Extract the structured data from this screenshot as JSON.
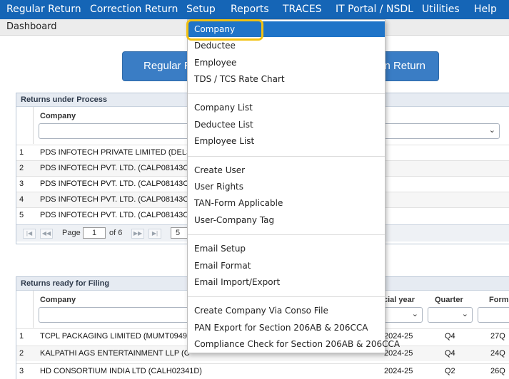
{
  "menubar": {
    "items": [
      "Regular Return",
      "Correction Return",
      "Setup",
      "Reports",
      "TRACES",
      "IT Portal / NSDL",
      "Utilities",
      "Help"
    ]
  },
  "breadcrumb": "Dashboard",
  "buttons": {
    "left_partial": "Regular R",
    "right_partial": "n Return"
  },
  "under_process": {
    "title": "Returns under Process",
    "col_company": "Company",
    "rows": [
      {
        "num": "1",
        "company": "PDS INFOTECH PRIVATE LIMITED (DELS"
      },
      {
        "num": "2",
        "company": "PDS INFOTECH PVT. LTD. (CALP08143C"
      },
      {
        "num": "3",
        "company": "PDS INFOTECH PVT. LTD. (CALP08143C"
      },
      {
        "num": "4",
        "company": "PDS INFOTECH PVT. LTD. (CALP08143C"
      },
      {
        "num": "5",
        "company": "PDS INFOTECH PVT. LTD. (CALP08143C"
      }
    ],
    "pager": {
      "page_label": "Page",
      "page_value": "1",
      "of_label": "of 6",
      "page_size": "5"
    }
  },
  "ready_filing": {
    "title": "Returns ready for Filing",
    "col_company": "Company",
    "col_year": "cial year",
    "col_quarter": "Quarter",
    "col_form": "Form",
    "rows": [
      {
        "num": "1",
        "company": "TCPL PACKAGING LIMITED (MUMT09495",
        "year": "2024-25",
        "quarter": "Q4",
        "form": "27Q"
      },
      {
        "num": "2",
        "company": "KALPATHI AGS ENTERTAINMENT LLP (C",
        "year": "2024-25",
        "quarter": "Q4",
        "form": "24Q"
      },
      {
        "num": "3",
        "company": "HD CONSORTIUM INDIA LTD (CALH02341D)",
        "year": "2024-25",
        "quarter": "Q2",
        "form": "26Q"
      }
    ]
  },
  "setup_menu": {
    "groups": [
      [
        "Company",
        "Deductee",
        "Employee",
        "TDS / TCS Rate Chart"
      ],
      [
        "Company List",
        "Deductee List",
        "Employee List"
      ],
      [
        "Create User",
        "User Rights",
        "TAN-Form Applicable",
        "User-Company Tag"
      ],
      [
        "Email Setup",
        "Email Format",
        "Email Import/Export"
      ],
      [
        "Create Company Via Conso File",
        "PAN Export for Section 206AB & 206CCA",
        "Compliance Check for Section 206AB & 206CCA"
      ]
    ],
    "selected": "Company"
  },
  "colors": {
    "menubar": "#1565b6",
    "highlight": "#1f74c8",
    "annotation_ring": "#f2c112"
  }
}
